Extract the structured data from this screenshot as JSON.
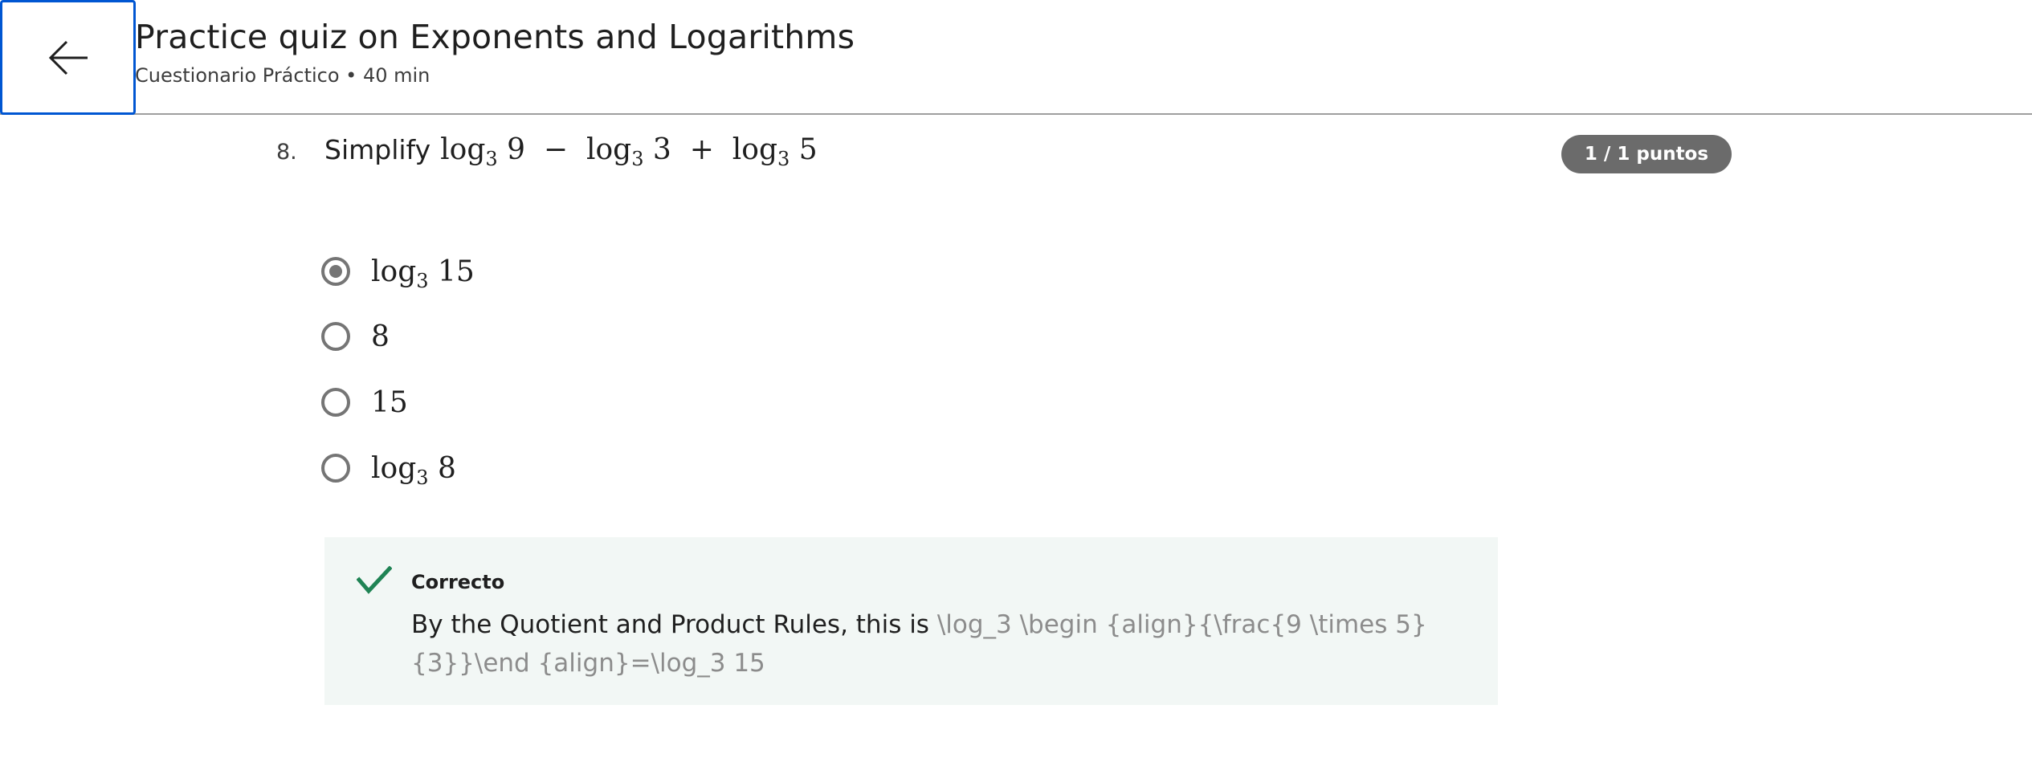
{
  "header": {
    "back_icon": "arrow-left-icon",
    "title": "Practice quiz on Exponents and Logarithms",
    "subtitle": "Cuestionario Práctico • 40 min"
  },
  "question": {
    "number": "8.",
    "prefix": "Simplify",
    "expression": {
      "parts": [
        {
          "fn": "log",
          "base": "3",
          "arg": "9"
        },
        {
          "op": "−"
        },
        {
          "fn": "log",
          "base": "3",
          "arg": "3"
        },
        {
          "op": "+"
        },
        {
          "fn": "log",
          "base": "3",
          "arg": "5"
        }
      ]
    },
    "points": "1 / 1 puntos"
  },
  "options": [
    {
      "fn": "log",
      "base": "3",
      "arg": "15",
      "selected": true
    },
    {
      "text": "8",
      "selected": false
    },
    {
      "text": "15",
      "selected": false
    },
    {
      "fn": "log",
      "base": "3",
      "arg": "8",
      "selected": false
    }
  ],
  "feedback": {
    "icon": "checkmark-icon",
    "icon_color": "#1f8354",
    "title": "Correcto",
    "body_text": "By the Quotient and Product Rules, this is ",
    "body_latex": "\\log_3 \\begin {align}{\\frac{9 \\times 5}{3}}\\end {align}=\\log_3 15"
  },
  "colors": {
    "accent_blue": "#0056d2",
    "badge_bg": "#6b6b6b",
    "feedback_bg": "#f2f7f5",
    "radio_gray": "#757575"
  }
}
